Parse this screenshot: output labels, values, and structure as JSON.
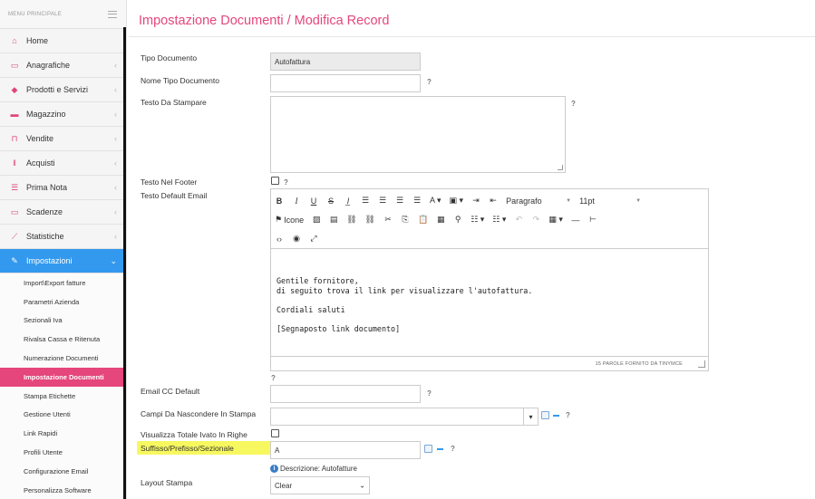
{
  "sidebar": {
    "header_label": "MENU PRINCIPALE",
    "items": [
      {
        "label": "Home",
        "icon": "home-icon",
        "has_chevron": false
      },
      {
        "label": "Anagrafiche",
        "icon": "id-card-icon",
        "has_chevron": true
      },
      {
        "label": "Prodotti e Servizi",
        "icon": "tag-icon",
        "has_chevron": true
      },
      {
        "label": "Magazzino",
        "icon": "truck-icon",
        "has_chevron": true
      },
      {
        "label": "Vendite",
        "icon": "basket-icon",
        "has_chevron": true
      },
      {
        "label": "Acquisti",
        "icon": "barcode-icon",
        "has_chevron": true
      },
      {
        "label": "Prima Nota",
        "icon": "list-icon",
        "has_chevron": true
      },
      {
        "label": "Scadenze",
        "icon": "money-icon",
        "has_chevron": true
      },
      {
        "label": "Statistiche",
        "icon": "chart-icon",
        "has_chevron": true
      },
      {
        "label": "Impostazioni",
        "icon": "wrench-icon",
        "has_chevron": true,
        "active": true
      }
    ],
    "sub_items": [
      "Import\\Export fatture",
      "Parametri Azienda",
      "Sezionali Iva",
      "Rivalsa Cassa e Ritenuta",
      "Numerazione Documenti",
      "Impostazione Documenti",
      "Stampa Etichette",
      "Gestione Utenti",
      "Link Rapidi",
      "Profili Utente",
      "Configurazione Email",
      "Personalizza Software"
    ],
    "selected_sub_item": "Impostazione Documenti"
  },
  "page": {
    "title": "Impostazione Documenti  /  Modifica Record"
  },
  "form": {
    "tipo_documento": {
      "label": "Tipo Documento",
      "value": "Autofattura"
    },
    "nome_tipo_documento": {
      "label": "Nome Tipo Documento",
      "value": ""
    },
    "testo_da_stampare": {
      "label": "Testo Da Stampare",
      "value": ""
    },
    "testo_nel_footer": {
      "label": "Testo Nel Footer",
      "checked": false
    },
    "testo_default_email": {
      "label": "Testo Default Email"
    },
    "email_cc_default": {
      "label": "Email CC Default",
      "value": ""
    },
    "campi_da_nascondere": {
      "label": "Campi Da Nascondere In Stampa",
      "value": ""
    },
    "visualizza_totale_ivato": {
      "label": "Visualizza Totale Ivato In Righe",
      "checked": false
    },
    "suffisso": {
      "label": "Suffisso/Prefisso/Sezionale",
      "value": "A",
      "description": "Descrizione: Autofatture"
    },
    "layout_stampa": {
      "label": "Layout Stampa",
      "value": "Clear"
    },
    "help_mark": "?"
  },
  "editor": {
    "toolbar": {
      "bold": "B",
      "italic": "I",
      "underline": "U",
      "strike": "S",
      "clear_format": "I̲",
      "paragraph_label": "Paragrafo",
      "font_size_label": "11pt",
      "icons_label": "Icone"
    },
    "content": [
      "Gentile fornitore,",
      "di seguito trova il link per visualizzare l'autofattura.",
      "Cordiali saluti",
      "[Segnaposto link documento]"
    ],
    "status": "15 PAROLE FORNITO DA TINYMCE"
  },
  "colors": {
    "accent": "#e5467c",
    "active_nav": "#3399ee",
    "highlight": "#f6f74e"
  }
}
